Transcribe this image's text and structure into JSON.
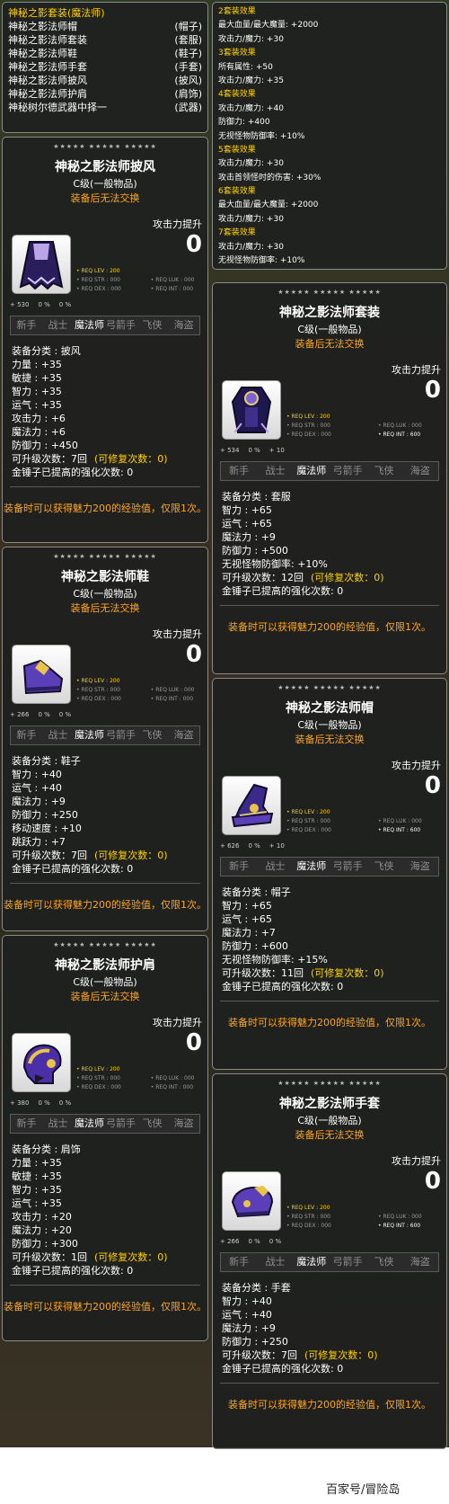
{
  "set_list": {
    "title": "神秘之影套装(魔法师)",
    "items": [
      {
        "name": "神秘之影法师帽",
        "type": "(帽子)"
      },
      {
        "name": "神秘之影法师套装",
        "type": "(套服)"
      },
      {
        "name": "神秘之影法师鞋",
        "type": "(鞋子)"
      },
      {
        "name": "神秘之影法师手套",
        "type": "(手套)"
      },
      {
        "name": "神秘之影法师披风",
        "type": "(披风)"
      },
      {
        "name": "神秘之影法师护肩",
        "type": "(肩饰)"
      },
      {
        "name": "神秘树尔德武器中择一",
        "type": "(武器)"
      }
    ]
  },
  "set_effects": {
    "lines": [
      {
        "text": "2套装效果",
        "style": "y"
      },
      {
        "text": "最大血量/最大魔量:  +2000",
        "style": "wht"
      },
      {
        "text": "攻击力/魔力:  +30",
        "style": "wht"
      },
      {
        "text": "3套装效果",
        "style": "y"
      },
      {
        "text": "所有属性:  +50",
        "style": "wht"
      },
      {
        "text": "攻击力/魔力:  +35",
        "style": "wht"
      },
      {
        "text": "4套装效果",
        "style": "y"
      },
      {
        "text": "攻击力/魔力:  +40",
        "style": "wht"
      },
      {
        "text": "防御力:  +400",
        "style": "wht"
      },
      {
        "text": "无视怪物防御率:  +10%",
        "style": "wht"
      },
      {
        "text": "5套装效果",
        "style": "y"
      },
      {
        "text": "攻击力/魔力:  +30",
        "style": "wht"
      },
      {
        "text": "攻击首领怪时的伤害:  +30%",
        "style": "wht"
      },
      {
        "text": "6套装效果",
        "style": "y"
      },
      {
        "text": "最大血量/最大魔量:  +2000",
        "style": "wht"
      },
      {
        "text": "攻击力/魔力:  +30",
        "style": "wht"
      },
      {
        "text": "7套装效果",
        "style": "y"
      },
      {
        "text": "攻击力/魔力:  +30",
        "style": "wht"
      },
      {
        "text": "无视怪物防御率:  +10%",
        "style": "wht"
      }
    ]
  },
  "common": {
    "stars": "★★★★★ ★★★★★ ★★★★★",
    "grade": "C级(一般物品)",
    "tradable": "装备后无法交换",
    "atk_label": "攻击力提升",
    "atk_value": "0",
    "req_lev": "• REQ LEV : 200",
    "req_str": "• REQ STR : 000",
    "req_dex": "• REQ DEX : 000",
    "req_luk": "• REQ LUK : 000",
    "req_int_0": "• REQ INT : 000",
    "req_int_600": "• REQ INT : 600",
    "mini_zero": "0 %",
    "mini_pct": "0 %",
    "jobs": [
      "新手",
      "战士",
      "魔法师",
      "弓箭手",
      "飞侠",
      "海盗"
    ],
    "footnote": "装备时可以获得魅力200的经验值，仅限1次。",
    "hammer": "金锤子已提高的强化次数:  0",
    "upgrade_label": "可升级次数：",
    "repair_prefix": "(可修复次数：",
    "repair_suffix": "0)"
  },
  "items": {
    "cape": {
      "name": "神秘之影法师披风",
      "mini1": "+ 530",
      "stats": [
        "装备分类 :  披风",
        "力量 :  +35",
        "敏捷 :  +35",
        "智力 :  +35",
        "运气 :  +35",
        "攻击力 :  +6",
        "魔法力 :  +6",
        "防御力 :  +450"
      ],
      "upgrades": "7回"
    },
    "suit": {
      "name": "神秘之影法师套装",
      "mini1": "+ 534",
      "mini3": "+ 10",
      "stats": [
        "装备分类 :  套服",
        "智力 :  +65",
        "运气 :  +65",
        "魔法力 :  +9",
        "防御力 :  +500",
        "无视怪物防御率:  +10%"
      ],
      "upgrades": "12回"
    },
    "shoes": {
      "name": "神秘之影法师鞋",
      "mini1": "+ 266",
      "stats": [
        "装备分类 :  鞋子",
        "智力 :  +40",
        "运气 :  +40",
        "魔法力 :  +9",
        "防御力 :  +250",
        "移动速度 :  +10",
        "跳跃力 :  +7"
      ],
      "upgrades": "7回"
    },
    "hat": {
      "name": "神秘之影法师帽",
      "mini1": "+ 626",
      "mini3": "+ 10",
      "stats": [
        "装备分类 :  帽子",
        "智力 :  +65",
        "运气 :  +65",
        "魔法力 :  +7",
        "防御力 :  +600",
        "无视怪物防御率:  +15%"
      ],
      "upgrades": "11回"
    },
    "shoulder": {
      "name": "神秘之影法师护肩",
      "mini1": "+ 380",
      "stats": [
        "装备分类 :  肩饰",
        "力量 :  +35",
        "敏捷 :  +35",
        "智力 :  +35",
        "运气 :  +35",
        "攻击力 :  +20",
        "魔法力 :  +20",
        "防御力 :  +300"
      ],
      "upgrades": "1回"
    },
    "gloves": {
      "name": "神秘之影法师手套",
      "mini1": "+ 266",
      "stats": [
        "装备分类 :  手套",
        "智力 :  +40",
        "运气 :  +40",
        "魔法力 :  +9",
        "防御力 :  +250"
      ],
      "upgrades": "7回"
    }
  },
  "watermark": "百家号/冒险岛"
}
